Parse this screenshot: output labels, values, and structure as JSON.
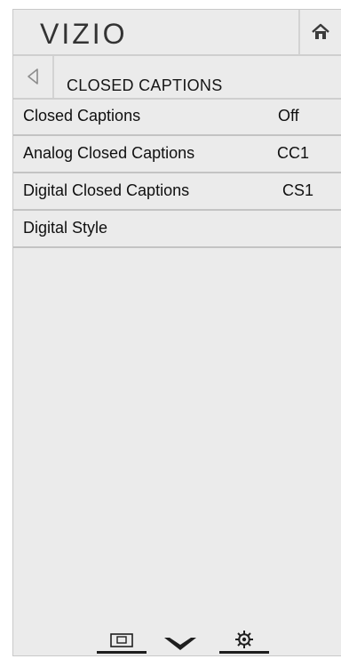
{
  "brand": {
    "logo_text": "VIZIO"
  },
  "header": {
    "home_icon": "home-icon"
  },
  "subheader": {
    "back_icon": "back-arrow-icon",
    "title": "CLOSED CAPTIONS"
  },
  "menu": {
    "items": [
      {
        "label": "Closed Captions",
        "value": "Off"
      },
      {
        "label": "Analog Closed Captions",
        "value": "CC1"
      },
      {
        "label": "Digital Closed Captions",
        "value": "CS1"
      },
      {
        "label": "Digital Style",
        "value": ""
      }
    ]
  },
  "footer": {
    "icons": [
      "picture-in-picture-icon",
      "vizio-v-icon",
      "settings-gear-icon"
    ]
  },
  "colors": {
    "panel": "#ebebeb",
    "divider": "#c3c3c3",
    "text": "#111111",
    "icon_dark": "#2b2b2b"
  }
}
